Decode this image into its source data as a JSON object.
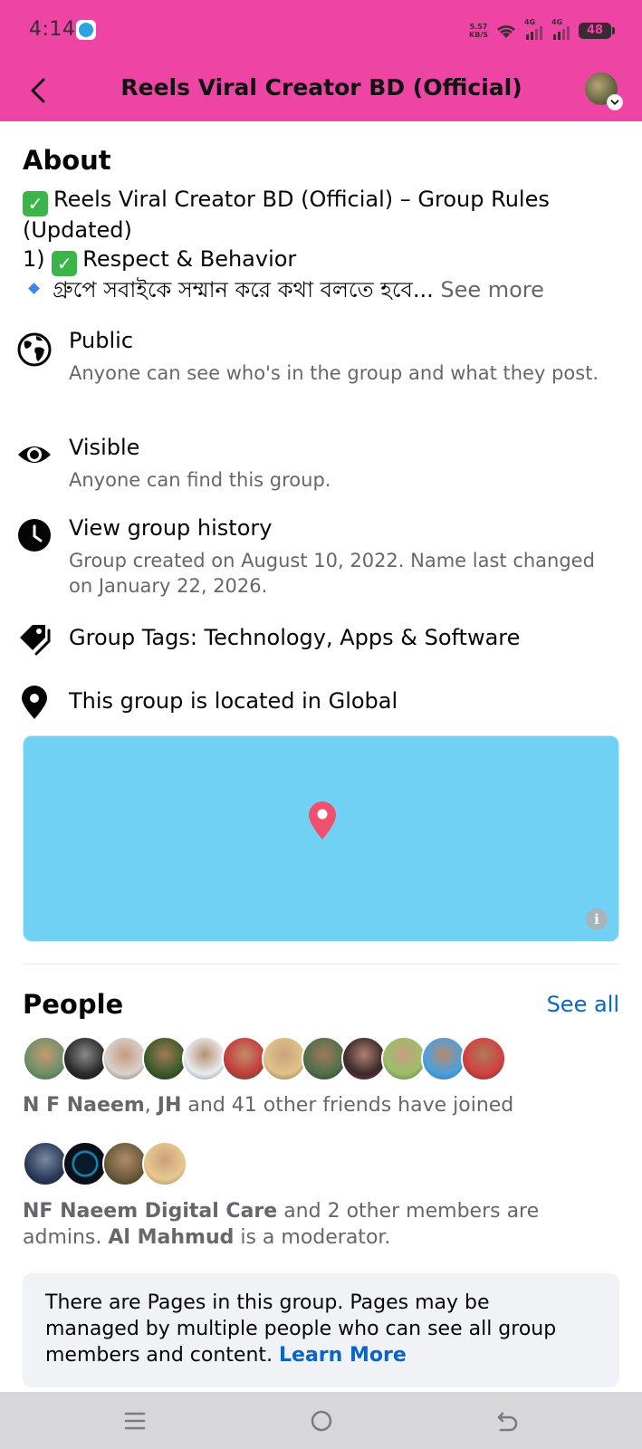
{
  "status_bar": {
    "time": "4:14",
    "net_speed_value": "5.57",
    "net_speed_unit": "KB/S",
    "signal1_label": "4G",
    "signal2_label": "4G",
    "battery": "48"
  },
  "header": {
    "title": "Reels Viral Creator BD (Official)"
  },
  "about": {
    "heading": "About",
    "line1": "Reels Viral Creator BD (Official) – Group Rules (Updated)",
    "line2_prefix": "1)",
    "line2": "Respect & Behavior",
    "line3": "গ্রুপে সবাইকে সম্মান করে কথা বলতে হবে...",
    "see_more": "See more"
  },
  "info": {
    "privacy_title": "Public",
    "privacy_sub": "Anyone can see who's in the group and what they post.",
    "visibility_title": "Visible",
    "visibility_sub": "Anyone can find this group.",
    "history_title": "View group history",
    "history_sub": "Group created on August 10, 2022. Name last changed on January 22, 2026.",
    "tags": "Group Tags: Technology, Apps & Software",
    "location": "This group is located in Global"
  },
  "map": {
    "info_glyph": "i"
  },
  "people": {
    "heading": "People",
    "see_all": "See all",
    "friends_name1": "N F Naeem",
    "friends_sep": ", ",
    "friends_name2": "JH",
    "friends_rest": " and 41 other friends have joined",
    "admins_name": "NF Naeem Digital Care",
    "admins_rest": " and 2 other members are admins. ",
    "moderator_name": "Al Mahmud",
    "moderator_rest": " is a moderator."
  },
  "notice": {
    "text": "There are Pages in this group. Pages may be managed by multiple people who can see all group members and content. ",
    "learn_more": "Learn More"
  },
  "colors": {
    "header_pink": "#ee45a5",
    "link_blue": "#0866c6",
    "map_blue": "#71d1f5",
    "pin_red": "#f0506e"
  }
}
